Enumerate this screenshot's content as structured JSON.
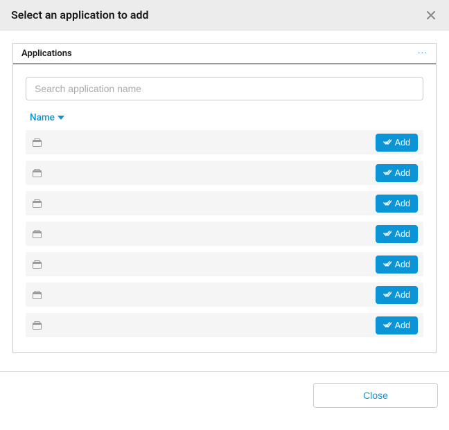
{
  "modal": {
    "title": "Select an application to add",
    "close_label": "Close"
  },
  "panel": {
    "title": "Applications"
  },
  "search": {
    "placeholder": "Search application name",
    "value": ""
  },
  "columns": {
    "name_label": "Name",
    "sort_dir": "asc"
  },
  "buttons": {
    "add_label": "Add"
  },
  "rows": [
    {
      "name": ""
    },
    {
      "name": ""
    },
    {
      "name": ""
    },
    {
      "name": ""
    },
    {
      "name": ""
    },
    {
      "name": ""
    },
    {
      "name": ""
    }
  ],
  "colors": {
    "accent": "#0c95d6"
  }
}
